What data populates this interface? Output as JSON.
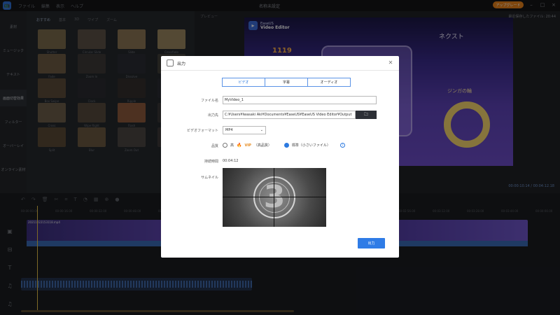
{
  "app": {
    "logo_glyph": "📺",
    "title": "名称未設定",
    "menu": [
      "ファイル",
      "編集",
      "表示",
      "ヘルプ"
    ],
    "upgrade_label": "アップグレード",
    "autosave": "最近保存したファイル: 20:44"
  },
  "sidebar": {
    "items": [
      "素材",
      "ミュージック",
      "テキスト",
      "画面切替効果",
      "フィルター",
      "オーバーレイ",
      "オンライン素材"
    ],
    "active_index": 3
  },
  "library": {
    "tabs": [
      "おすすめ",
      "基本",
      "3D",
      "ワイプ",
      "ズーム"
    ],
    "thumbnails": [
      {
        "label": "Shutter",
        "color": "#7a6a4c"
      },
      {
        "label": "Circular Slide",
        "color": "#5b5146"
      },
      {
        "label": "Slide",
        "color": "#8b7655"
      },
      {
        "label": "Crossfade",
        "color": "#9a8660"
      },
      {
        "label": "Fade",
        "color": "#6e5c44"
      },
      {
        "label": "Zoom In",
        "color": "#3d3a37"
      },
      {
        "label": "Dissolve",
        "color": "#2b2d33"
      },
      {
        "label": "Burn",
        "color": "#413e3a"
      },
      {
        "label": "Box Swipe",
        "color": "#5b4c39"
      },
      {
        "label": "Clock",
        "color": "#2a2b30"
      },
      {
        "label": "Ripple",
        "color": "#342f2d"
      },
      {
        "label": "Slide Left",
        "color": "#2a2c33"
      },
      {
        "label": "Cross",
        "color": "#6c5d49"
      },
      {
        "label": "Wipe Right",
        "color": "#57493c"
      },
      {
        "label": "Flash",
        "color": "#8d5a3c"
      },
      {
        "label": "Push",
        "color": "#3a3837"
      },
      {
        "label": "Split",
        "color": "#5a4a36"
      },
      {
        "label": "Blur",
        "color": "#6a5841"
      },
      {
        "label": "Zoom Out",
        "color": "#4c4642"
      },
      {
        "label": "Wipe",
        "color": "#3c3a39"
      }
    ]
  },
  "preview": {
    "tabs": [
      "プレビュー"
    ],
    "watermark_brand": "EaseUS",
    "watermark_product": "Video Editor",
    "game_next": "ネクスト",
    "game_score": "1119",
    "game_label": "ジンガの輪",
    "timecode": "00:00:10.14 / 00:04:12.18"
  },
  "timeline": {
    "ruler": [
      "00:00:00.00",
      "00:00:16.00",
      "00:00:32.00",
      "00:00:48.00",
      "00:01:04.00",
      "00:01:20.00",
      "00:01:36.00",
      "00:01:52.00",
      "00:02:08.00",
      "00:02:24.00",
      "00:02:40.00",
      "00:02:56.00",
      "00:03:12.00",
      "00:03:28.00",
      "00:03:44.00",
      "00:04:00.00"
    ],
    "video_label": "20211222153118.mp4",
    "track_icons": [
      "▣",
      "⊟",
      "T",
      "♫",
      "♫"
    ]
  },
  "dialog": {
    "title": "出力",
    "tabs": [
      "ビデオ",
      "字幕",
      "オーディオ"
    ],
    "active_tab": 0,
    "filename_label": "ファイル名",
    "filename_value": "MyVideo_1",
    "output_label": "出力先",
    "output_value": "C:¥Users¥Iwasaki Aki¥Documents¥EaseUS¥EaseUS Video Editor¥Output",
    "format_label": "ビデオフォーマット",
    "format_value": "MP4",
    "quality_label": "品質",
    "quality_high_prefix": "高",
    "quality_vip": "VIP",
    "quality_high_suffix": "（高品質）",
    "quality_standard": "標準（小さいファイル）",
    "duration_label": "持続時間",
    "duration_value": "00:04:12",
    "thumbnail_label": "サムネイル",
    "thumbnail_digit": "3",
    "export_label": "出力"
  }
}
